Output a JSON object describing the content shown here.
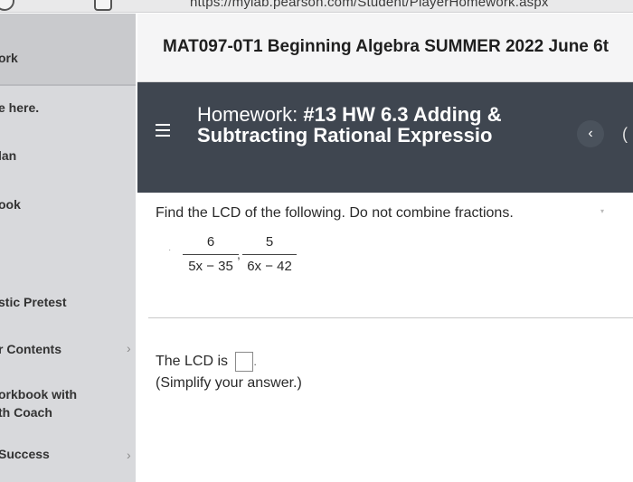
{
  "browser": {
    "url": "https://mylab.pearson.com/Student/PlayerHomework.aspx"
  },
  "sidebar": {
    "items": [
      {
        "label": "ork"
      },
      {
        "label": "e here."
      },
      {
        "label": "lan"
      },
      {
        "label": "ook"
      },
      {
        "label": "stic Pretest"
      },
      {
        "label": "r Contents"
      },
      {
        "label": "orkbook with"
      },
      {
        "label": "th Coach"
      },
      {
        "label": "Success"
      }
    ]
  },
  "header": {
    "course_title": "MAT097-0T1 Beginning Algebra SUMMER 2022 June 6t"
  },
  "homework": {
    "prefix": "Homework: ",
    "title": "#13 HW 6.3 Adding & Subtracting Rational Expressio",
    "prev_icon": "chevron-left-icon",
    "next_icon": "chevron-right-icon"
  },
  "question": {
    "prompt": "Find the LCD of the following. Do not combine fractions.",
    "fractions": [
      {
        "numerator": "6",
        "denominator": "5x − 35"
      },
      {
        "numerator": "5",
        "denominator": "6x − 42"
      }
    ],
    "separator": ",",
    "answer_label": "The LCD is",
    "answer_value": "",
    "answer_suffix": ".",
    "hint": "(Simplify your answer.)"
  },
  "colors": {
    "header_bg": "#3f4650",
    "sidebar_bg": "#d8d9dc",
    "text": "#2a2a2a"
  }
}
